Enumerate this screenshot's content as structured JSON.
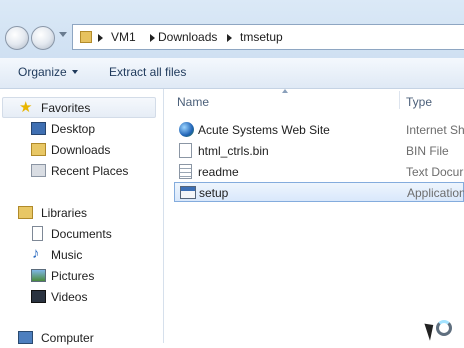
{
  "address_bar": {
    "breadcrumbs": [
      "VM1",
      "Downloads",
      "tmsetup"
    ]
  },
  "toolbar": {
    "organize_label": "Organize",
    "extract_label": "Extract all files"
  },
  "nav_pane": {
    "favorites_label": "Favorites",
    "favorites": [
      "Desktop",
      "Downloads",
      "Recent Places"
    ],
    "libraries_label": "Libraries",
    "libraries": [
      "Documents",
      "Music",
      "Pictures",
      "Videos"
    ],
    "computer_label": "Computer"
  },
  "file_list": {
    "columns": {
      "name": "Name",
      "type": "Type"
    },
    "rows": [
      {
        "name": "Acute Systems Web Site",
        "type": "Internet Sh",
        "icon": "globe-icon"
      },
      {
        "name": "html_ctrls.bin",
        "type": "BIN File",
        "icon": "file-icon"
      },
      {
        "name": "readme",
        "type": "Text Docur",
        "icon": "text-file-icon"
      },
      {
        "name": "setup",
        "type": "Application",
        "icon": "application-icon",
        "selected": true
      }
    ]
  }
}
